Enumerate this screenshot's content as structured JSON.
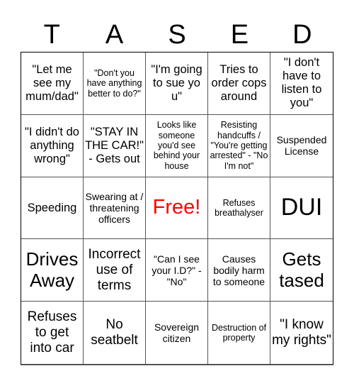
{
  "card": {
    "header_letters": [
      "T",
      "A",
      "S",
      "E",
      "D"
    ],
    "free_color": "#ff0000",
    "rows": [
      [
        "\"Let me see my mum/dad\"",
        "\"Don't you have anything better to do?\"",
        "\"I'm going to sue yo u\"",
        "Tries to order cops around",
        "\"I don't have to listen to you\""
      ],
      [
        "\"I didn't do anything wrong\"",
        "\"STAY IN THE CAR!\" - Gets out",
        "Looks like someone you'd see behind your house",
        "Resisting handcuffs / \"You're getting arrested\" - \"No I'm not\"",
        "Suspended License"
      ],
      [
        "Speeding",
        "Swearing at / threatening officers",
        "Free!",
        "Refuses breathalyser",
        "DUI"
      ],
      [
        "Drives Away",
        "Incorrect use of terms",
        "\"Can I see your I.D?\" - \"No\"",
        "Causes bodily harm to someone",
        "Gets tased"
      ],
      [
        "Refuses to get into car",
        "No seatbelt",
        "Sovereign citizen",
        "Destruction of property",
        "\"I know my rights\""
      ]
    ]
  }
}
